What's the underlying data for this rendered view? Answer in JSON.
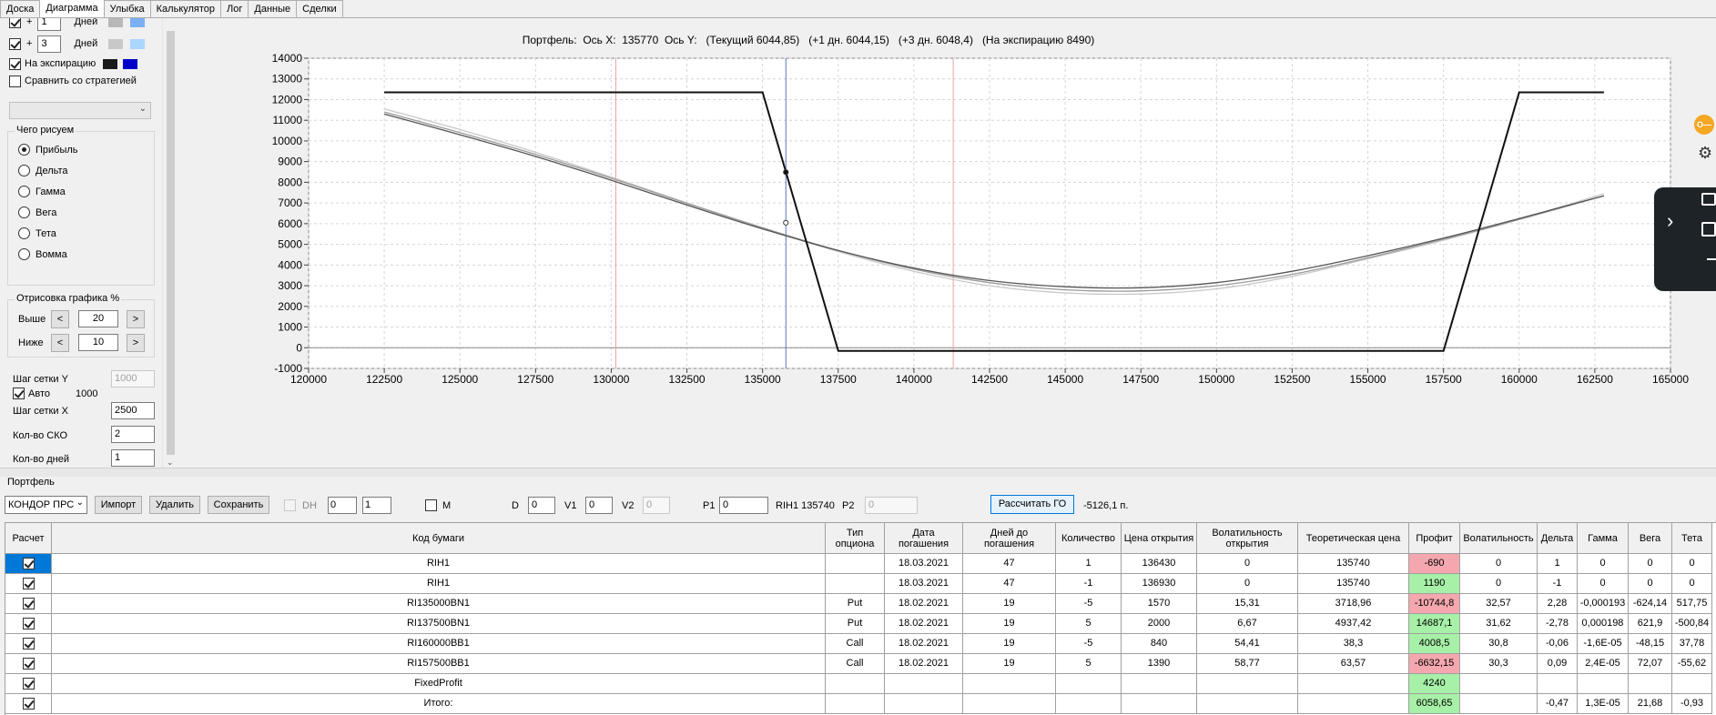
{
  "tabs": [
    "Доска",
    "Диаграмма",
    "Улыбка",
    "Калькулятор",
    "Лог",
    "Данные",
    "Сделки"
  ],
  "active_tab": 1,
  "left": {
    "plus_rows": [
      {
        "sign": "+",
        "value": "1",
        "unit": "Дней",
        "color1": "#b8b8b8",
        "color2": "#7ab0f5"
      },
      {
        "sign": "+",
        "value": "3",
        "unit": "Дней",
        "color1": "#c8c8c8",
        "color2": "#aad6ff"
      }
    ],
    "expiry_label": "На экспирацию",
    "expiry_color1": "#1a1a1a",
    "expiry_color2": "#0000c8",
    "compare_label": "Сравнить со стратегией",
    "draw_group": "Чего рисуем",
    "radios": [
      "Прибыль",
      "Дельта",
      "Гамма",
      "Вега",
      "Тета",
      "Вомма"
    ],
    "render_group": "Отрисовка графика %",
    "above_label": "Выше",
    "above_value": "20",
    "below_label": "Ниже",
    "below_value": "10",
    "btn_left": "<",
    "btn_right": ">",
    "grid_y_label": "Шаг сетки Y",
    "grid_y_value": "1000",
    "auto_label": "Авто",
    "auto_value": "1000",
    "grid_x_label": "Шаг сетки X",
    "grid_x_value": "2500",
    "sko_label": "Кол-во СКО",
    "sko_value": "2",
    "days_label": "Кол-во дней",
    "days_value": "1"
  },
  "chart_data": {
    "type": "line",
    "title": "Портфель:  Ось X:  135770  Ось Y:   (Текущий 6044,85)   (+1 дн. 6044,15)   (+3 дн. 6048,4)   (На экспирацию 8490)",
    "xlim": [
      120000,
      165000
    ],
    "ylim": [
      -1000,
      14000
    ],
    "xticks": [
      "120000",
      "122500",
      "125000",
      "127500",
      "130000",
      "132500",
      "135000",
      "137500",
      "140000",
      "142500",
      "145000",
      "147500",
      "150000",
      "152500",
      "155000",
      "157500",
      "160000",
      "162500",
      "165000"
    ],
    "yticks": [
      "14000",
      "13000",
      "12000",
      "11000",
      "10000",
      "9000",
      "8000",
      "7000",
      "6000",
      "5000",
      "4000",
      "3000",
      "2000",
      "1000",
      "0",
      "-1000"
    ],
    "grid": true,
    "red_vlines": [
      130150,
      141300
    ],
    "blue_vline": 135770,
    "series": [
      {
        "key": "expiry",
        "color": "#111111",
        "x": [
          122500,
          135000,
          137500,
          157500,
          160000,
          162800
        ],
        "y": [
          12350,
          12350,
          -150,
          -150,
          12350,
          12350
        ]
      },
      {
        "key": "current",
        "color": "#555555",
        "x": [
          122500,
          125000,
          127500,
          130000,
          132500,
          135000,
          137500,
          140000,
          142500,
          145000,
          147500,
          150000,
          152500,
          155000,
          157500,
          160000,
          162800
        ],
        "y": [
          11300,
          10300,
          9250,
          8100,
          6900,
          5750,
          4700,
          3850,
          3250,
          2950,
          2900,
          3150,
          3700,
          4450,
          5300,
          6250,
          7350
        ]
      },
      {
        "key": "plus1",
        "color": "#9a9a9a",
        "x": [
          122500,
          125000,
          127500,
          130000,
          132500,
          135000,
          137500,
          140000,
          142500,
          145000,
          147500,
          150000,
          152500,
          155000,
          157500,
          160000,
          162800
        ],
        "y": [
          11400,
          10400,
          9350,
          8200,
          6980,
          5800,
          4700,
          3800,
          3150,
          2800,
          2750,
          3000,
          3550,
          4350,
          5250,
          6200,
          7350
        ]
      },
      {
        "key": "plus3",
        "color": "#c8c8c8",
        "x": [
          122500,
          125000,
          127500,
          130000,
          132500,
          135000,
          137500,
          140000,
          142500,
          145000,
          147500,
          150000,
          152500,
          155000,
          157500,
          160000,
          162800
        ],
        "y": [
          11550,
          10550,
          9450,
          8250,
          7000,
          5800,
          4650,
          3700,
          3000,
          2650,
          2600,
          2850,
          3450,
          4300,
          5200,
          6200,
          7450
        ]
      }
    ],
    "markers": [
      {
        "x": 135770,
        "y": 8490,
        "fill": "#111111"
      },
      {
        "x": 135770,
        "y": 6045,
        "fill": "#ffffff"
      }
    ]
  },
  "side_widget": {
    "key_color": "#f5a623"
  },
  "portfolio": {
    "section_label": "Портфель",
    "strategy": "КОНДОР ПРС",
    "import": "Импорт",
    "delete": "Удалить",
    "save": "Сохранить",
    "dh_label": "DH",
    "dh_value1": "0",
    "dh_value2": "1",
    "m_label": "M",
    "d_label": "D",
    "d_value": "0",
    "v1_label": "V1",
    "v1_value": "0",
    "v2_label": "V2",
    "v2_value": "0",
    "p1_label": "P1",
    "p1_value": "0",
    "ri_text": "RIH1 135740",
    "p2_label": "P2",
    "p2_value": "0",
    "calc_go": "Рассчитать ГО",
    "go_value": "-5126,1 п."
  },
  "table": {
    "headers": [
      "Расчет",
      "Код бумаги",
      "Тип опциона",
      "Дата погашения",
      "Дней до погашения",
      "Количество",
      "Цена открытия",
      "Волатильность открытия",
      "Теоретическая цена",
      "Профит",
      "Волатильность",
      "Дельта",
      "Гамма",
      "Вега",
      "Тета"
    ],
    "rows": [
      {
        "calc": true,
        "selected": true,
        "cells": [
          "RIH1",
          "",
          "18.03.2021",
          "47",
          "1",
          "136430",
          "0",
          "135740",
          "-690",
          "0",
          "1",
          "0",
          "0",
          "0"
        ],
        "profit": "red"
      },
      {
        "calc": true,
        "cells": [
          "RIH1",
          "",
          "18.03.2021",
          "47",
          "-1",
          "136930",
          "0",
          "135740",
          "1190",
          "0",
          "-1",
          "0",
          "0",
          "0"
        ],
        "profit": "green"
      },
      {
        "calc": true,
        "cells": [
          "RI135000BN1",
          "Put",
          "18.02.2021",
          "19",
          "-5",
          "1570",
          "15,31",
          "3718,96",
          "-10744,8",
          "32,57",
          "2,28",
          "-0,000193",
          "-624,14",
          "517,75"
        ],
        "profit": "red"
      },
      {
        "calc": true,
        "cells": [
          "RI137500BN1",
          "Put",
          "18.02.2021",
          "19",
          "5",
          "2000",
          "6,67",
          "4937,42",
          "14687,1",
          "31,62",
          "-2,78",
          "0,000198",
          "621,9",
          "-500,84"
        ],
        "profit": "green"
      },
      {
        "calc": true,
        "cells": [
          "RI160000BB1",
          "Call",
          "18.02.2021",
          "19",
          "-5",
          "840",
          "54,41",
          "38,3",
          "4008,5",
          "30,8",
          "-0,06",
          "-1,6E-05",
          "-48,15",
          "37,78"
        ],
        "profit": "green"
      },
      {
        "calc": true,
        "cells": [
          "RI157500BB1",
          "Call",
          "18.02.2021",
          "19",
          "5",
          "1390",
          "58,77",
          "63,57",
          "-6632,15",
          "30,3",
          "0,09",
          "2,4E-05",
          "72,07",
          "-55,62"
        ],
        "profit": "red"
      },
      {
        "calc": true,
        "cells": [
          "FixedProfit",
          "",
          "",
          "",
          "",
          "",
          "",
          "",
          "4240",
          "",
          "",
          "",
          "",
          ""
        ],
        "profit": "green"
      },
      {
        "calc": true,
        "cells": [
          "Итого:",
          "",
          "",
          "",
          "",
          "",
          "",
          "",
          "6058,65",
          "",
          "-0,47",
          "1,3E-05",
          "21,68",
          "-0,93"
        ],
        "profit": "green"
      }
    ]
  }
}
